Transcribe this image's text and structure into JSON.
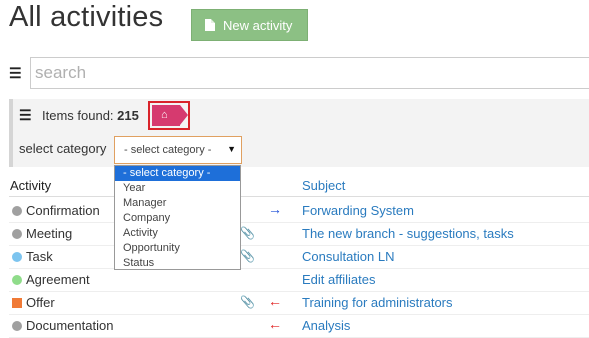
{
  "page": {
    "title": "All activities",
    "new_button": "New activity"
  },
  "search": {
    "placeholder": "search"
  },
  "filter": {
    "items_found_label": "Items found:",
    "items_found_count": "215",
    "category_label": "select category",
    "selected_value": "- select category -",
    "options": [
      "- select category -",
      "Year",
      "Manager",
      "Company",
      "Activity",
      "Opportunity",
      "Status"
    ]
  },
  "table": {
    "columns": {
      "activity": "Activity",
      "subject": "Subject"
    },
    "rows": [
      {
        "activity": "Confirmation",
        "status_color": "#a0a0a0",
        "shape": "circle",
        "attachment": false,
        "direction": "right",
        "direction_color": "#1e4fd8",
        "subject": "Forwarding System"
      },
      {
        "activity": "Meeting",
        "status_color": "#a0a0a0",
        "shape": "circle",
        "attachment": true,
        "direction": "",
        "direction_color": "",
        "subject": "The new branch - suggestions, tasks"
      },
      {
        "activity": "Task",
        "status_color": "#7cc4ef",
        "shape": "circle",
        "attachment": true,
        "direction": "",
        "direction_color": "",
        "subject": "Consultation LN"
      },
      {
        "activity": "Agreement",
        "status_color": "#8fdc8a",
        "shape": "circle",
        "attachment": false,
        "direction": "",
        "direction_color": "",
        "subject": "Edit affiliates"
      },
      {
        "activity": "Offer",
        "status_color": "#f07a36",
        "shape": "square",
        "attachment": true,
        "direction": "left",
        "direction_color": "#e02020",
        "subject": "Training for administrators"
      },
      {
        "activity": "Documentation",
        "status_color": "#a0a0a0",
        "shape": "circle",
        "attachment": false,
        "direction": "left",
        "direction_color": "#e02020",
        "subject": "Analysis"
      }
    ]
  }
}
